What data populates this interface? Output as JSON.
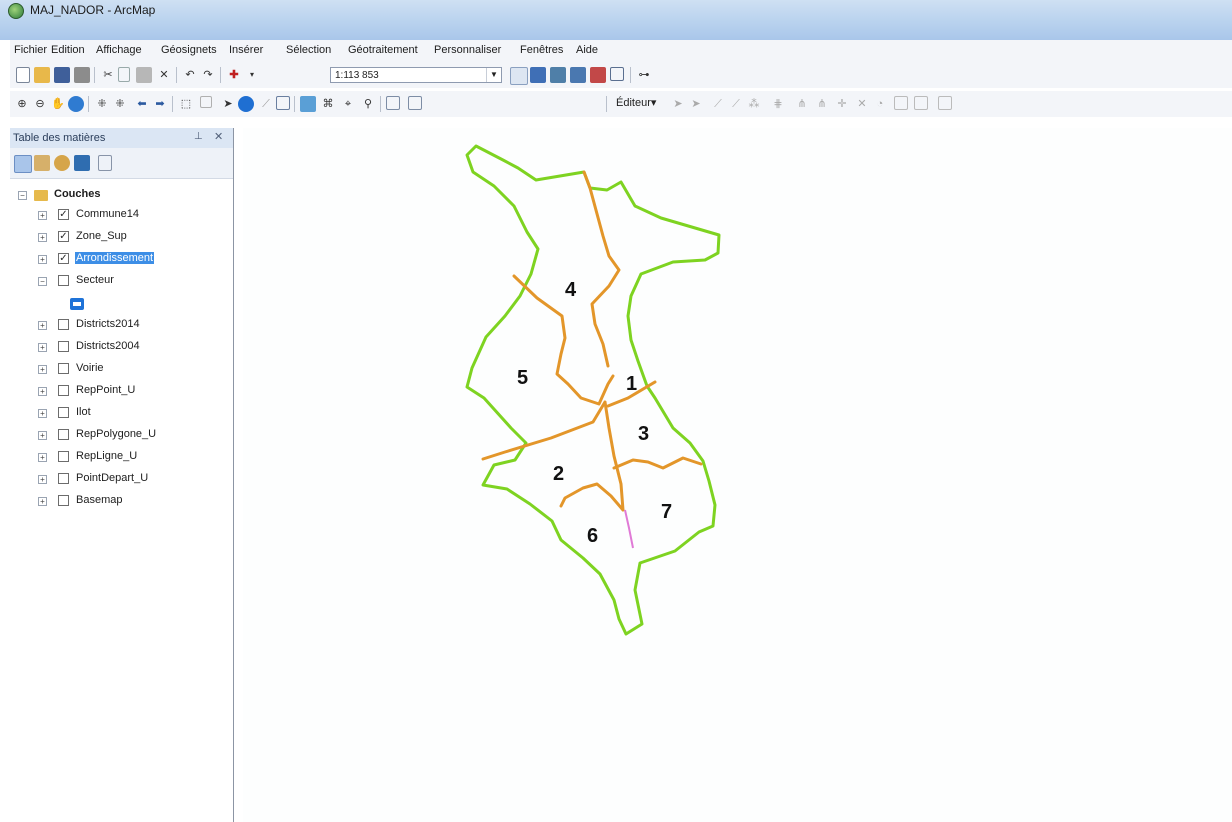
{
  "window": {
    "title": "MAJ_NADOR - ArcMap"
  },
  "menu": [
    "Fichier",
    "Edition",
    "Affichage",
    "Géosignets",
    "Insérer",
    "Sélection",
    "Géotraitement",
    "Personnaliser",
    "Fenêtres",
    "Aide"
  ],
  "toolbar": {
    "scale": "1:113 853",
    "editor_label": "Éditeur▾"
  },
  "toc": {
    "title": "Table des matières",
    "root_label": "Couches",
    "layers": [
      {
        "name": "Commune14",
        "checked": true,
        "expanded": false,
        "selected": false
      },
      {
        "name": "Zone_Sup",
        "checked": true,
        "expanded": false,
        "selected": false
      },
      {
        "name": "Arrondissement",
        "checked": true,
        "expanded": false,
        "selected": true
      },
      {
        "name": "Secteur",
        "checked": false,
        "expanded": true,
        "selected": false
      },
      {
        "name": "Districts2014",
        "checked": false,
        "expanded": false,
        "selected": false
      },
      {
        "name": "Districts2004",
        "checked": false,
        "expanded": false,
        "selected": false
      },
      {
        "name": "Voirie",
        "checked": false,
        "expanded": false,
        "selected": false
      },
      {
        "name": "RepPoint_U",
        "checked": false,
        "expanded": false,
        "selected": false
      },
      {
        "name": "Ilot",
        "checked": false,
        "expanded": false,
        "selected": false
      },
      {
        "name": "RepPolygone_U",
        "checked": false,
        "expanded": false,
        "selected": false
      },
      {
        "name": "RepLigne_U",
        "checked": false,
        "expanded": false,
        "selected": false
      },
      {
        "name": "PointDepart_U",
        "checked": false,
        "expanded": false,
        "selected": false
      },
      {
        "name": "Basemap",
        "checked": false,
        "expanded": false,
        "selected": false
      }
    ]
  },
  "map": {
    "district_labels": [
      "1",
      "2",
      "3",
      "4",
      "5",
      "6",
      "7"
    ],
    "colors": {
      "boundary": "#7ed321",
      "internal": "#e3962a",
      "highlight": "#e07ad6"
    }
  }
}
